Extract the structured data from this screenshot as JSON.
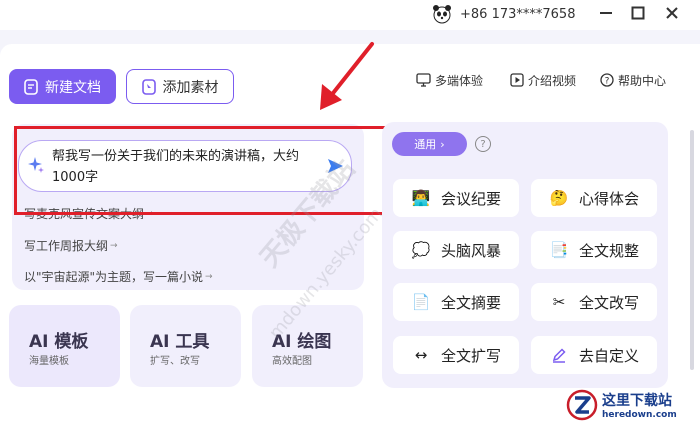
{
  "topbar": {
    "phone": "+86 173****7658"
  },
  "header": {
    "new_doc": "新建文档",
    "add_material": "添加素材",
    "links": [
      {
        "label": "多端体验",
        "icon": "monitor-icon"
      },
      {
        "label": "介绍视频",
        "icon": "play-icon"
      },
      {
        "label": "帮助中心",
        "icon": "help-icon"
      }
    ]
  },
  "prompt": {
    "text": "帮我写一份关于我们的未来的演讲稿，大约1000字",
    "suggestions": [
      "写麦克风宣传文案大纲",
      "写工作周报大纲",
      "以\"宇宙起源\"为主题，写一篇小说"
    ]
  },
  "tools": [
    {
      "title": "AI 模板",
      "sub": "海量模板"
    },
    {
      "title": "AI 工具",
      "sub": "扩写、改写"
    },
    {
      "title": "AI 绘图",
      "sub": "高效配图"
    }
  ],
  "right_panel": {
    "category": "通用",
    "options": [
      {
        "label": "会议纪要",
        "icon": "meeting-icon"
      },
      {
        "label": "心得体会",
        "icon": "thinking-icon"
      },
      {
        "label": "头脑风暴",
        "icon": "brainstorm-icon"
      },
      {
        "label": "全文规整",
        "icon": "organize-icon"
      },
      {
        "label": "全文摘要",
        "icon": "summary-icon"
      },
      {
        "label": "全文改写",
        "icon": "rewrite-icon"
      },
      {
        "label": "全文扩写",
        "icon": "expand-icon"
      },
      {
        "label": "去自定义",
        "icon": "edit-icon"
      }
    ]
  },
  "watermark": {
    "line1": "天极下载站",
    "line2": "mdown.yesky.com"
  },
  "logo": {
    "cn": "这里下载站",
    "en": "heredown.com"
  },
  "colors": {
    "accent": "#7b5cf0",
    "highlight": "#e01f2a"
  }
}
